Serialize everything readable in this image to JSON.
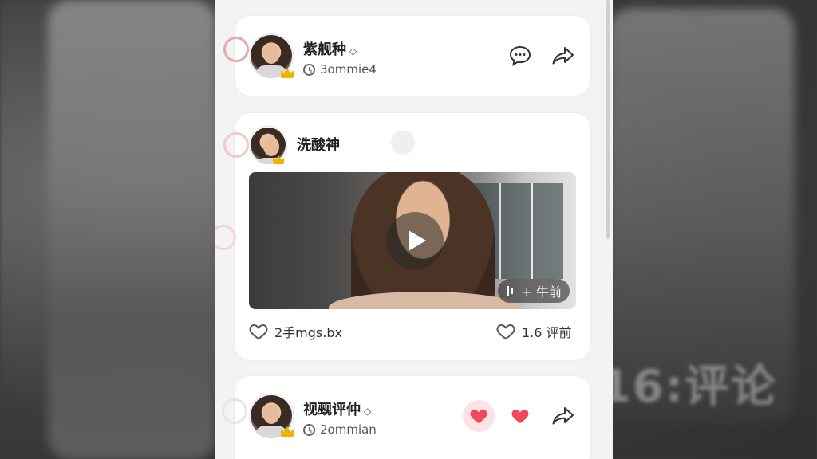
{
  "colors": {
    "accent_red": "#f0485c",
    "ring_pink": "#f3c8cc",
    "card_bg": "#ffffff",
    "page_bg": "#f3f3f3"
  },
  "posts": [
    {
      "name": "紫舰种",
      "badge": "◇",
      "time": "3ommie4",
      "actions": [
        "comment-icon",
        "share-icon"
      ]
    },
    {
      "name": "洗酸神",
      "badge": "—",
      "video_tag": "+ 牛前",
      "likes_text": "2手mgs.bx",
      "comments_text": "1.6 评前",
      "actions": [
        "heart-outline-icon",
        "heart-outline-icon"
      ]
    },
    {
      "name": "视觋评仲",
      "badge": "◇",
      "time": "2ommian",
      "actions": [
        "heart-filled-icon",
        "heart-filled-icon",
        "share-icon"
      ]
    }
  ],
  "background_text": "16:评论"
}
